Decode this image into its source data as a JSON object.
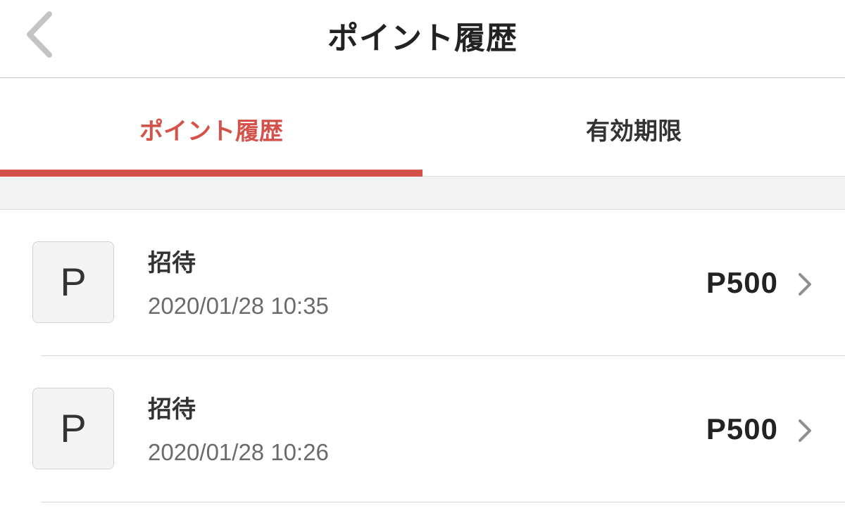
{
  "header": {
    "title": "ポイント履歴",
    "back_icon": "chevron-left-icon"
  },
  "tabs": [
    {
      "label": "ポイント履歴",
      "active": true
    },
    {
      "label": "有効期限",
      "active": false
    }
  ],
  "colors": {
    "accent": "#d4524a",
    "divider": "#d6d6d6",
    "spacer_bg": "#f3f3f3"
  },
  "history": [
    {
      "icon_letter": "P",
      "title": "招待",
      "datetime": "2020/01/28 10:35",
      "amount": "P500"
    },
    {
      "icon_letter": "P",
      "title": "招待",
      "datetime": "2020/01/28 10:26",
      "amount": "P500"
    }
  ]
}
